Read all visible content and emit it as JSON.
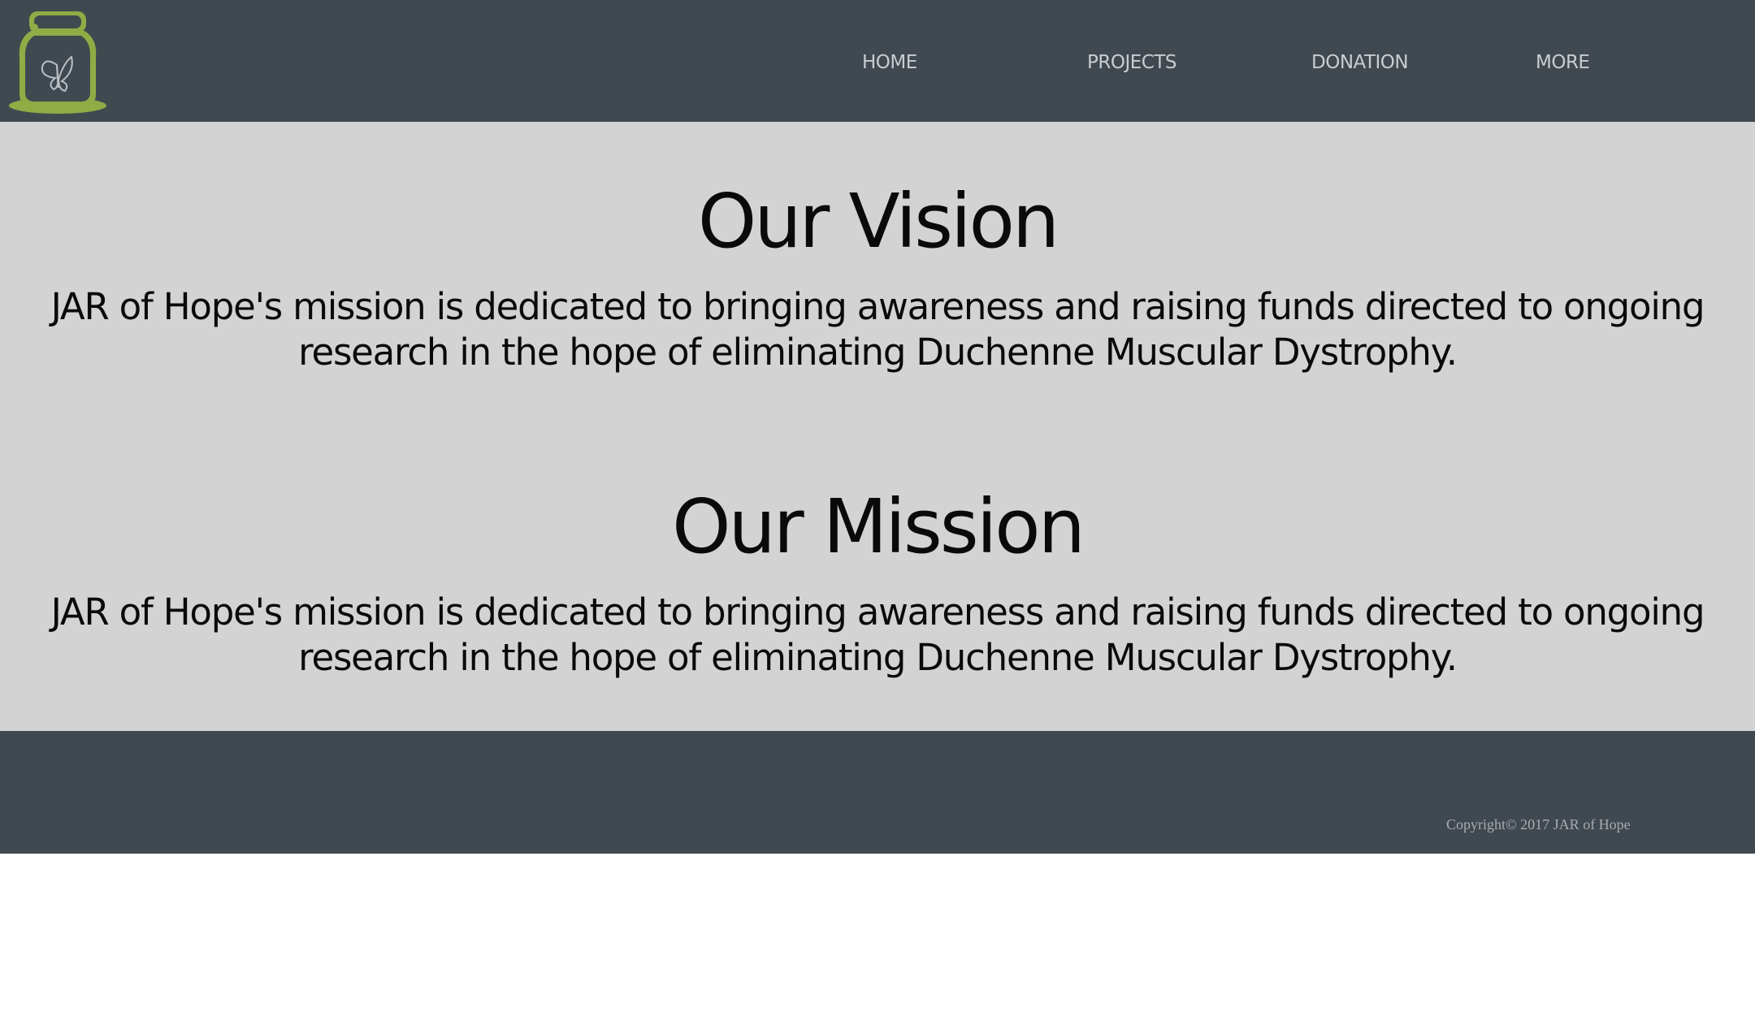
{
  "brand": {
    "logo_icon": "jar-butterfly-icon",
    "logo_color": "#8fac45"
  },
  "nav": {
    "items": [
      {
        "label": "HOME"
      },
      {
        "label": "PROJECTS"
      },
      {
        "label": "DONATION"
      },
      {
        "label": "MORE"
      }
    ]
  },
  "vision": {
    "title": "Our Vision",
    "text": "JAR of Hope's mission is dedicated to bringing awareness and raising funds directed to ongoing research in the hope of eliminating Duchenne Muscular Dystrophy."
  },
  "mission": {
    "title": "Our Mission",
    "text": "JAR of Hope's mission is dedicated to bringing awareness and raising funds directed to ongoing research in the hope of eliminating Duchenne Muscular Dystrophy."
  },
  "footer": {
    "copyright": "Copyright© 2017 JAR of Hope"
  },
  "colors": {
    "header_bg": "#414950",
    "main_bg": "#d3d3d3",
    "footer_bg": "#414950"
  }
}
